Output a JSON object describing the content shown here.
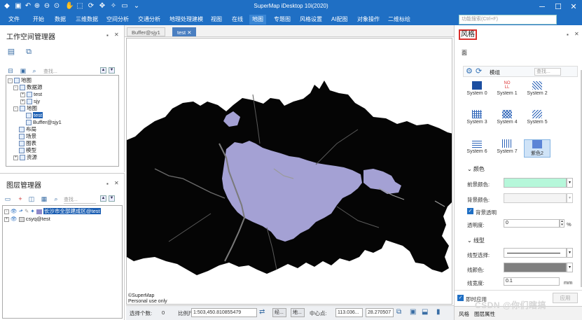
{
  "app": {
    "title": "SuperMap iDesktop 10i(2020)"
  },
  "menu": [
    "文件",
    "开始",
    "数据",
    "三维数据",
    "空间分析",
    "交通分析",
    "地理处理建模",
    "视图",
    "在线",
    "地图",
    "专题图",
    "风格设置",
    "AI配图",
    "对象操作",
    "二维标绘"
  ],
  "search_placeholder": "功能搜索(Ctrl+F)",
  "workspace": {
    "title": "工作空间管理器",
    "search_placeholder": "查找...",
    "tree": [
      "地图",
      "数据源",
      "test",
      "sjy",
      "地图",
      "test",
      "Buffer@sjy1",
      "布局",
      "场景",
      "图表",
      "模型",
      "资源"
    ]
  },
  "layers": {
    "title": "图层管理器",
    "search_placeholder": "查找...",
    "items": [
      "长沙市全部建成区@test",
      "csyq@test"
    ]
  },
  "tabs": [
    "Buffer@sjy1",
    "test"
  ],
  "map": {
    "copyright": "©SuperMap",
    "license": "Personal use only",
    "fill_color": "#a4a1d4"
  },
  "status": {
    "select_label": "选择个数:",
    "select_count": "0",
    "scale_label": "比例尺:",
    "scale_value": "1:503,450.810855479",
    "btn1": "经...",
    "btn2": "地...",
    "center_label": "中心点:",
    "center_x": "113.036...",
    "center_y": "28.270507"
  },
  "style": {
    "title": "风格",
    "face_label": "面",
    "group_label": "模组",
    "search_placeholder": "查找...",
    "symbols": [
      "System 0",
      "System 1",
      "System 2",
      "System 3",
      "System 4",
      "System 5",
      "System 6",
      "System 7",
      "紫色2"
    ],
    "color_section": "颜色",
    "fore_color_label": "前景颜色:",
    "fore_color": "#b6f7da",
    "back_color_label": "背景颜色:",
    "transparent_bg_label": "背景透明",
    "opacity_label": "透明度:",
    "opacity_value": "0",
    "opacity_unit": "%",
    "line_section": "线型",
    "line_select_label": "线型选择:",
    "line_color_label": "线颜色:",
    "line_color": "#7f7f7f",
    "line_width_label": "线宽度:",
    "line_width_value": "0.1",
    "line_width_unit": "mm",
    "instant_apply_label": "即时应用",
    "apply_button": "应用",
    "bottom_tabs": [
      "风格",
      "图层属性"
    ]
  },
  "watermark": "CSDN @你们瞎搞"
}
